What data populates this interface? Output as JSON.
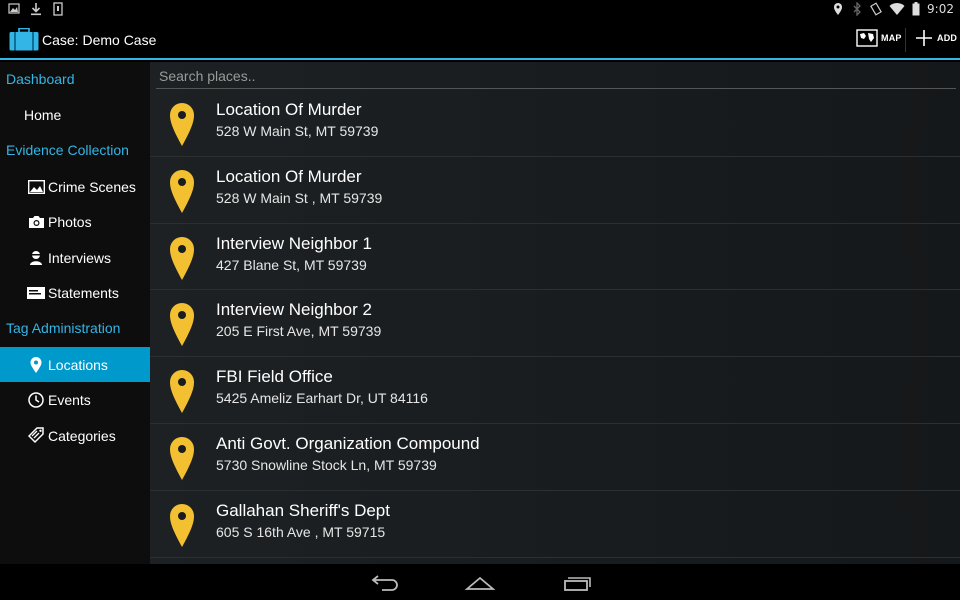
{
  "status_bar": {
    "time": "9:02",
    "left_icons": [
      "image-icon",
      "download-icon",
      "phone-storage-icon"
    ],
    "right_icons": [
      "location-icon",
      "bluetooth-icon",
      "rotate-icon",
      "wifi-icon",
      "battery-icon"
    ]
  },
  "action_bar": {
    "title": "Case: Demo Case",
    "map_label": "MAP",
    "add_label": "ADD",
    "accent": "#33b5e5"
  },
  "sidebar": {
    "sections": [
      {
        "header": "Dashboard",
        "items": [
          {
            "label": "Home",
            "icon": ""
          }
        ]
      },
      {
        "header": "Evidence Collection",
        "items": [
          {
            "label": "Crime Scenes",
            "icon": "picture-icon"
          },
          {
            "label": "Photos",
            "icon": "camera-icon"
          },
          {
            "label": "Interviews",
            "icon": "person-icon"
          },
          {
            "label": "Statements",
            "icon": "card-icon"
          }
        ]
      },
      {
        "header": "Tag Administration",
        "items": [
          {
            "label": "Locations",
            "icon": "pin-icon",
            "active": true
          },
          {
            "label": "Events",
            "icon": "clock-icon"
          },
          {
            "label": "Categories",
            "icon": "tags-icon"
          }
        ]
      }
    ],
    "active_color": "#0099cc"
  },
  "search": {
    "placeholder": "Search places..",
    "value": ""
  },
  "places": [
    {
      "name": "Location Of Murder",
      "address": "528 W Main St, MT 59739"
    },
    {
      "name": "Location Of Murder",
      "address": "528 W Main St , MT 59739"
    },
    {
      "name": "Interview Neighbor 1",
      "address": "427 Blane St, MT 59739"
    },
    {
      "name": "Interview Neighbor 2",
      "address": "205 E First Ave, MT 59739"
    },
    {
      "name": "FBI Field Office",
      "address": "5425 Ameliz Earhart Dr, UT 84116"
    },
    {
      "name": "Anti Govt. Organization Compound",
      "address": "5730 Snowline Stock Ln, MT 59739"
    },
    {
      "name": "Gallahan Sheriff's Dept",
      "address": "605 S 16th Ave , MT 59715"
    }
  ],
  "pin_color": "#f2c031",
  "nav_bar": {
    "buttons": [
      "back-icon",
      "home-icon",
      "recents-icon"
    ]
  }
}
